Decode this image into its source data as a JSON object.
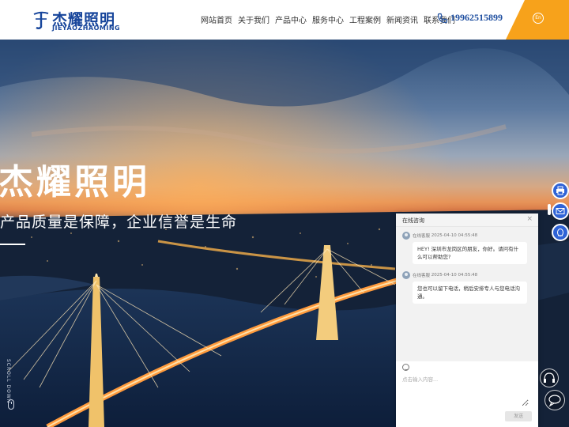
{
  "brand": {
    "name": "杰耀照明",
    "pinyin": "JIEYAOZHAOMING"
  },
  "nav": {
    "items": [
      "网站首页",
      "关于我们",
      "产品中心",
      "服务中心",
      "工程案例",
      "新闻资讯",
      "联系我们"
    ]
  },
  "contact": {
    "phone": "19962515899"
  },
  "lang": {
    "label": "En"
  },
  "hero": {
    "title": "杰耀照明",
    "subtitle": "产品质量是保障，企业信誉是生命",
    "scroll_label": "SCROLL DOWN"
  },
  "chat": {
    "title": "在线咨询",
    "close_label": "×",
    "messages": [
      {
        "sender": "在线客服",
        "time": "2025-04-10 04:55:48",
        "text": "HEY! 深圳市龙岗区的朋友，你好。请问有什么可以帮助您?"
      },
      {
        "sender": "在线客服",
        "time": "2025-04-10 04:55:48",
        "text": "您也可以留下电话，稍后安排专人与您电话沟通。"
      }
    ],
    "input_placeholder": "点击输入内容...",
    "send_label": "发送"
  },
  "colors": {
    "brand_blue": "#17459b",
    "accent_orange": "#f7a21b",
    "float_blue": "#2f63d6"
  },
  "icons": {
    "phone": "phone-icon",
    "lang": "globe-icon",
    "float": [
      "print-icon",
      "mail-icon",
      "qq-icon"
    ],
    "bottom": [
      "headset-icon",
      "chat-bubble-icon"
    ]
  }
}
